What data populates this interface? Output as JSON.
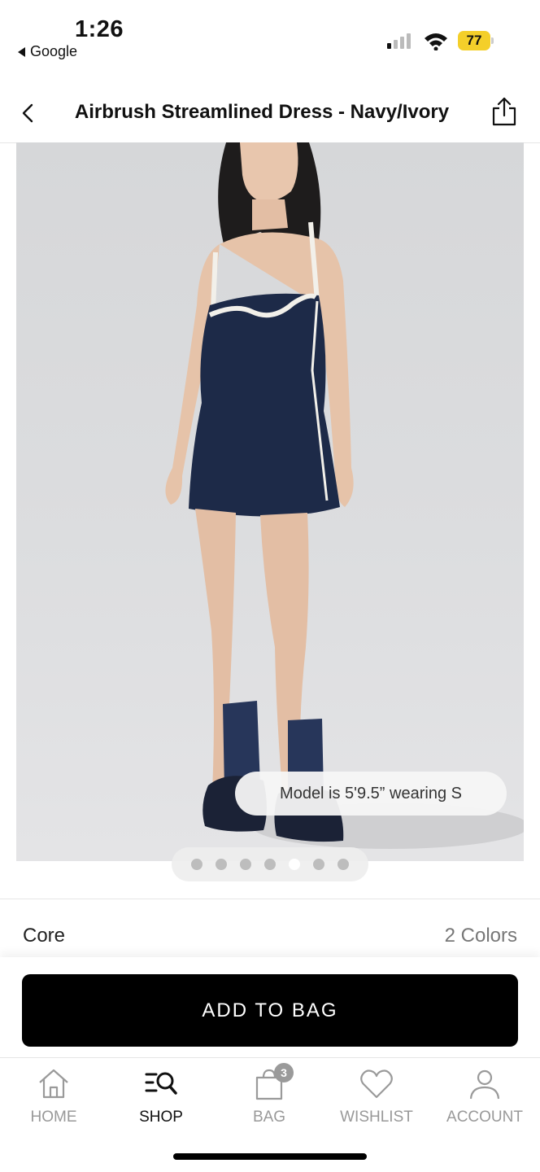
{
  "status_bar": {
    "time": "1:26",
    "back_app": "Google",
    "battery": "77",
    "signal_bars_active": 1,
    "battery_color": "#f4cf2a"
  },
  "header": {
    "title": "Airbrush Streamlined Dress - Navy/Ivory",
    "back_icon": "chevron-left-icon",
    "share_icon": "share-icon"
  },
  "product": {
    "model_caption": "Model is 5'9.5” wearing S",
    "image_count": 7,
    "active_image_index": 4,
    "dress_color": "#1d2a48",
    "trim_color": "#f2f0ea"
  },
  "meta": {
    "collection": "Core",
    "colors": "2 Colors"
  },
  "cta": {
    "add_to_bag": "ADD TO BAG"
  },
  "tab_bar": {
    "items": [
      {
        "label": "HOME",
        "icon": "home-icon"
      },
      {
        "label": "SHOP",
        "icon": "shop-search-icon"
      },
      {
        "label": "BAG",
        "icon": "bag-icon",
        "badge": "3"
      },
      {
        "label": "WISHLIST",
        "icon": "heart-icon"
      },
      {
        "label": "ACCOUNT",
        "icon": "account-icon"
      }
    ],
    "active": "SHOP"
  }
}
